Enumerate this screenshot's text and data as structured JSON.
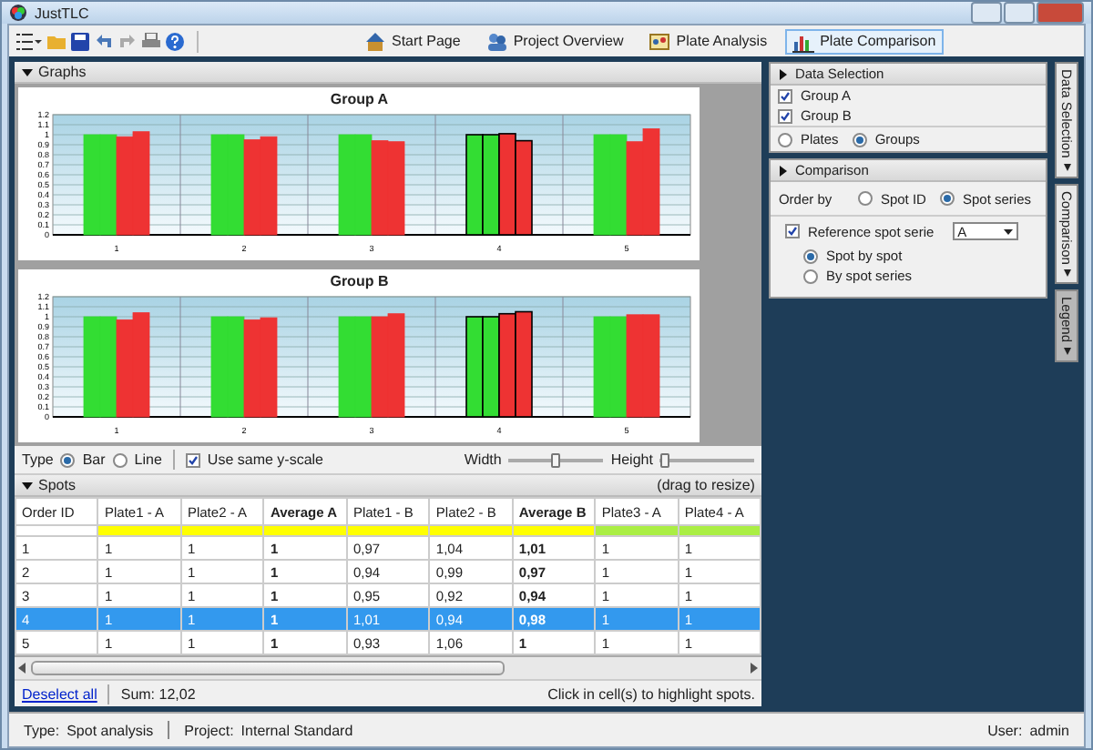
{
  "window": {
    "title": "JustTLC"
  },
  "toolbar": {
    "nav": [
      {
        "label": "Start Page",
        "kind": "home",
        "selected": false
      },
      {
        "label": "Project Overview",
        "kind": "people",
        "selected": false
      },
      {
        "label": "Plate Analysis",
        "kind": "plate",
        "selected": false
      },
      {
        "label": "Plate Comparison",
        "kind": "chart",
        "selected": true
      }
    ]
  },
  "graphs": {
    "header": "Graphs",
    "charts": [
      {
        "title": "Group A",
        "chart_data": {
          "type": "bar",
          "grid": true,
          "categories": [
            "1",
            "2",
            "3",
            "4",
            "5"
          ],
          "yticks": [
            0,
            0.1,
            0.2,
            0.3,
            0.4,
            0.5,
            0.6,
            0.7,
            0.8,
            0.9,
            1,
            1.1,
            1.2
          ],
          "ylim": [
            0,
            1.2
          ],
          "series": [
            {
              "color": "#33dd33",
              "values": [
                1,
                1,
                1,
                1,
                1
              ]
            },
            {
              "color": "#33dd33",
              "values": [
                1,
                1,
                1,
                1,
                1
              ]
            },
            {
              "color": "#ee3333",
              "values": [
                0.98,
                0.95,
                0.94,
                1.01,
                0.93
              ]
            },
            {
              "color": "#ee3333",
              "values": [
                1.03,
                0.98,
                0.93,
                0.94,
                1.06
              ]
            }
          ]
        }
      },
      {
        "title": "Group B",
        "chart_data": {
          "type": "bar",
          "grid": true,
          "categories": [
            "1",
            "2",
            "3",
            "4",
            "5"
          ],
          "yticks": [
            0,
            0.1,
            0.2,
            0.3,
            0.4,
            0.5,
            0.6,
            0.7,
            0.8,
            0.9,
            1,
            1.1,
            1.2
          ],
          "ylim": [
            0,
            1.2
          ],
          "series": [
            {
              "color": "#33dd33",
              "values": [
                1,
                1,
                1,
                1,
                1
              ]
            },
            {
              "color": "#33dd33",
              "values": [
                1,
                1,
                1,
                1,
                1
              ]
            },
            {
              "color": "#ee3333",
              "values": [
                0.97,
                0.97,
                1,
                1.03,
                1.02
              ]
            },
            {
              "color": "#ee3333",
              "values": [
                1.04,
                0.99,
                1.03,
                1.05,
                1.02
              ]
            }
          ]
        }
      }
    ],
    "options": {
      "type_label": "Type",
      "types": [
        {
          "label": "Bar",
          "selected": true
        },
        {
          "label": "Line",
          "selected": false
        }
      ],
      "same_scale": {
        "label": "Use same y-scale",
        "checked": true
      },
      "width": {
        "label": "Width",
        "level": 0.5
      },
      "height": {
        "label": "Height",
        "level": 0.05
      }
    }
  },
  "spots": {
    "header": "Spots",
    "hint": "(drag to resize)",
    "columns": [
      {
        "label": "Order ID",
        "kind": "id"
      },
      {
        "label": "Plate1 - A",
        "kind": "plate",
        "color": "#ffff00"
      },
      {
        "label": "Plate2 - A",
        "kind": "plate",
        "color": "#ffff00"
      },
      {
        "label": "Average A",
        "kind": "average",
        "color": "#ffff00"
      },
      {
        "label": "Plate1 - B",
        "kind": "plate",
        "color": "#ffff00"
      },
      {
        "label": "Plate2 - B",
        "kind": "plate",
        "color": "#ffff00"
      },
      {
        "label": "Average B",
        "kind": "average",
        "color": "#ffff00"
      },
      {
        "label": "Plate3 - A",
        "kind": "plate",
        "color": "#aaee44"
      },
      {
        "label": "Plate4 - A",
        "kind": "plate",
        "color": "#aaee44"
      }
    ],
    "rows": [
      {
        "selected": false,
        "cells": [
          "1",
          "1",
          "1",
          "1",
          "0,97",
          "1,04",
          "1,01",
          "1",
          "1"
        ]
      },
      {
        "selected": false,
        "cells": [
          "2",
          "1",
          "1",
          "1",
          "0,94",
          "0,99",
          "0,97",
          "1",
          "1"
        ]
      },
      {
        "selected": false,
        "cells": [
          "3",
          "1",
          "1",
          "1",
          "0,95",
          "0,92",
          "0,94",
          "1",
          "1"
        ]
      },
      {
        "selected": true,
        "cells": [
          "4",
          "1",
          "1",
          "1",
          "1,01",
          "0,94",
          "0,98",
          "1",
          "1"
        ]
      },
      {
        "selected": false,
        "cells": [
          "5",
          "1",
          "1",
          "1",
          "0,93",
          "1,06",
          "1",
          "1",
          "1"
        ]
      }
    ],
    "deselect": "Deselect all",
    "sum": "Sum: 12,02",
    "info": "Click in cell(s) to highlight spots."
  },
  "data_selection": {
    "header": "Data Selection",
    "groups": [
      {
        "label": "Group A",
        "checked": true
      },
      {
        "label": "Group B",
        "checked": true
      }
    ],
    "modes": [
      {
        "label": "Plates",
        "selected": false
      },
      {
        "label": "Groups",
        "selected": true
      }
    ]
  },
  "comparison": {
    "header": "Comparison",
    "order_label": "Order by",
    "order": [
      {
        "label": "Spot ID",
        "selected": false
      },
      {
        "label": "Spot series",
        "selected": true
      }
    ],
    "reference": {
      "label": "Reference spot serie",
      "checked": true,
      "value": "A"
    },
    "ref_modes": [
      {
        "label": "Spot by spot",
        "selected": true
      },
      {
        "label": "By spot series",
        "selected": false
      }
    ]
  },
  "side_tabs": [
    {
      "label": "Data Selection",
      "selected": false
    },
    {
      "label": "Comparison",
      "selected": false
    },
    {
      "label": "Legend",
      "selected": true
    }
  ],
  "status": {
    "type_label": "Type:",
    "type_value": "Spot analysis",
    "project_label": "Project:",
    "project_value": "Internal Standard",
    "user_label": "User:",
    "user_value": "admin"
  }
}
